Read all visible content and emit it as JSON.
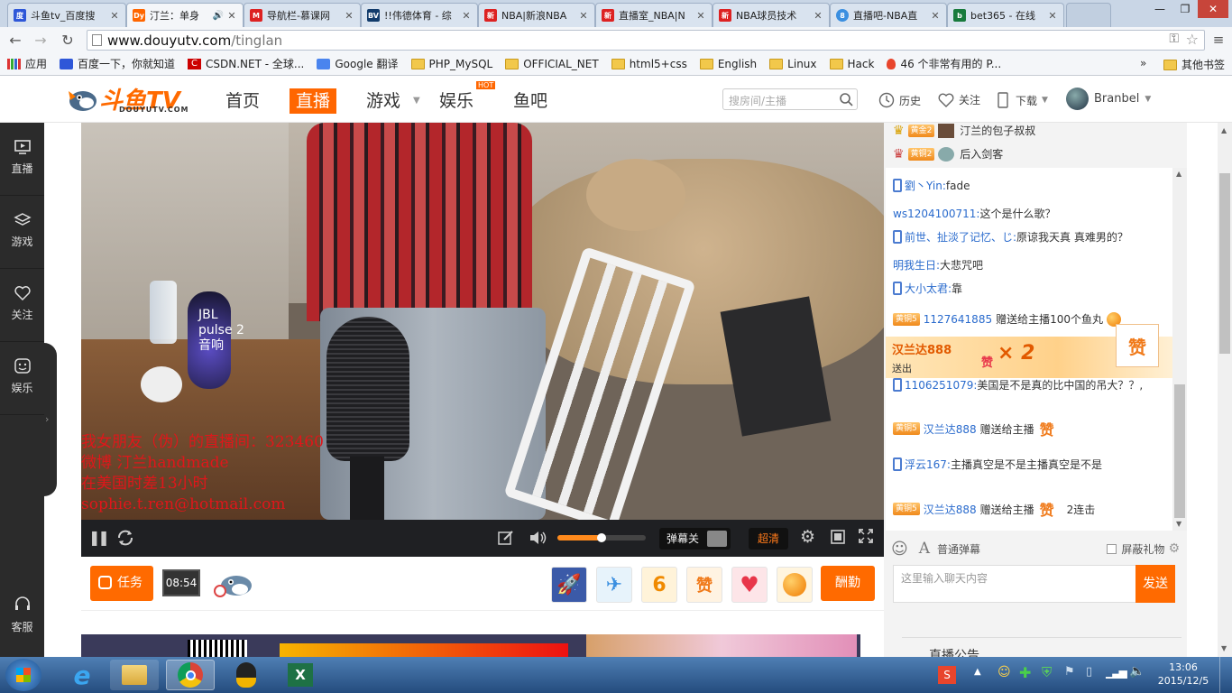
{
  "browser": {
    "tabs": [
      {
        "title": "斗鱼tv_百度搜",
        "icon": "baidu-icon",
        "color": "#2e57d8"
      },
      {
        "title": "汀兰：单身",
        "icon": "douyu-icon",
        "color": "#f60",
        "active": true,
        "audio": true
      },
      {
        "title": "导航栏-慕课网",
        "icon": "imooc-icon",
        "color": "#d22"
      },
      {
        "title": "!!伟德体育 - 综",
        "icon": "bv-icon",
        "color": "#123b6b"
      },
      {
        "title": "NBA|新浪NBA",
        "icon": "sina-icon",
        "color": "#d22"
      },
      {
        "title": "直播室_NBA|N",
        "icon": "sina-icon",
        "color": "#d22"
      },
      {
        "title": "NBA球员技术",
        "icon": "sina-icon",
        "color": "#d22"
      },
      {
        "title": "直播吧-NBA直",
        "icon": "zhibo8-icon",
        "color": "#3b8fe0"
      },
      {
        "title": "bet365 - 在线",
        "icon": "bet365-icon",
        "color": "#187a3c"
      }
    ],
    "url_host": "www.douyutv.com",
    "url_path": "/tinglan",
    "bookmarks": [
      {
        "label": "应用",
        "icon": "apps-icon"
      },
      {
        "label": "百度一下，你就知道",
        "icon": "baidu-icon"
      },
      {
        "label": "CSDN.NET - 全球...",
        "icon": "csdn-icon"
      },
      {
        "label": "Google 翻译",
        "icon": "translate-icon"
      },
      {
        "label": "PHP_MySQL",
        "icon": "folder-icon"
      },
      {
        "label": "OFFICIAL_NET",
        "icon": "folder-icon"
      },
      {
        "label": "html5+css",
        "icon": "folder-icon"
      },
      {
        "label": "English",
        "icon": "folder-icon"
      },
      {
        "label": "Linux",
        "icon": "folder-icon"
      },
      {
        "label": "Hack",
        "icon": "folder-icon"
      },
      {
        "label": "46 个非常有用的 P...",
        "icon": "fire-icon"
      }
    ],
    "bookmarks_more": "»",
    "other_bookmarks": "其他书签"
  },
  "site": {
    "logo_main": "斗鱼TV",
    "logo_sub": "DOUYUTV.COM",
    "nav": [
      "首页",
      "直播",
      "游戏",
      "娱乐",
      "鱼吧"
    ],
    "hot_badge": "HOT",
    "search_placeholder": "搜房间/主播",
    "history": "历史",
    "follow": "关注",
    "download": "下载",
    "username": "Branbel",
    "accent": "#ff6600"
  },
  "leftbar": {
    "items": [
      "直播",
      "游戏",
      "关注",
      "娱乐"
    ],
    "service": "客服"
  },
  "video": {
    "overlay_lines": [
      "我女朋友（伪）的直播间：323460",
      "微博 汀兰handmade",
      "在美国时差13小时",
      "sophie.t.ren@hotmail.com"
    ],
    "jbl_lines": [
      "JBL",
      "pulse 2",
      "音响"
    ]
  },
  "controls": {
    "danmu_off": "弹幕关",
    "quality": "超清",
    "volume_level": 0.5
  },
  "bottombar": {
    "task": "任务",
    "clock": "08:54",
    "reward": "酬勤"
  },
  "chat": {
    "top_ranks": [
      {
        "badge": "黄金2",
        "name": "汀兰的包子叔叔"
      },
      {
        "badge": "黄铜2",
        "name": "后入剑客"
      }
    ],
    "messages": [
      {
        "type": "phone",
        "user": "劉丶Yin:",
        "text": "fade"
      },
      {
        "type": "text",
        "user": "ws1204100711:",
        "text": "这个是什么歌？"
      },
      {
        "type": "phone",
        "user": "前世、扯淡了记忆、じ:",
        "text": "原谅我天真 真难男的？"
      },
      {
        "type": "text",
        "user": "明我生日:",
        "text": "大悲咒吧"
      },
      {
        "type": "phone",
        "user": "大小太君:",
        "text": "靠"
      },
      {
        "type": "gift",
        "badge": "黄铜5",
        "user": "1127641885",
        "text": "赠送给主播100个鱼丸"
      },
      {
        "type": "phone",
        "user": "1106251079:",
        "text": "美国是不是真的比中国的吊大？？,"
      },
      {
        "type": "gift",
        "badge": "黄铜5",
        "user": "汉兰达888",
        "text": "赠送给主播"
      },
      {
        "type": "phone",
        "user": "浮云167:",
        "text": "主播真空是不是主播真空是不是"
      },
      {
        "type": "gift",
        "badge": "黄铜5",
        "user": "汉兰达888",
        "text": "赠送给主播",
        "combo": "2连击"
      }
    ],
    "gift_banner": {
      "user": "汉兰达888",
      "action": "送出",
      "multiplier": "× 2",
      "gift_label": "赞"
    },
    "danmu_mode": "普通弹幕",
    "block_gift": "屏蔽礼物",
    "input_placeholder": "这里输入聊天内容",
    "send": "发送",
    "notice": "直播公告"
  },
  "taskbar": {
    "time": "13:06",
    "date": "2015/12/5"
  }
}
